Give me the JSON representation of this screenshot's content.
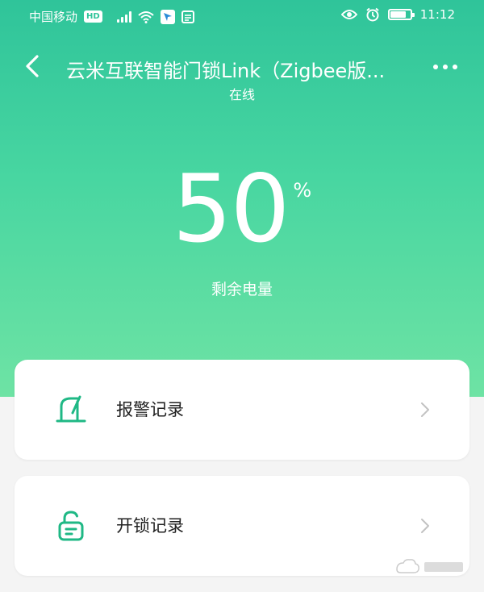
{
  "status_bar": {
    "carrier": "中国移动",
    "network_badge": "HD",
    "time": "11:12",
    "battery_level": 0.8,
    "icons": [
      "signal-icon",
      "wifi-icon",
      "app-notification-icon",
      "message-icon",
      "eye-icon",
      "alarm-icon",
      "battery-icon"
    ]
  },
  "header": {
    "title": "云米互联智能门锁Link（Zigbee版...",
    "status": "在线",
    "back_icon": "back-arrow-icon",
    "more_icon": "more-dots-icon"
  },
  "battery": {
    "value": "50",
    "unit": "%",
    "label": "剩余电量"
  },
  "records": [
    {
      "label": "报警记录",
      "icon": "alarm-record-icon"
    },
    {
      "label": "开锁记录",
      "icon": "unlock-record-icon"
    }
  ],
  "colors": {
    "gradient_top": "#2fc49a",
    "gradient_bottom": "#6ee3a4",
    "accent": "#1fb885",
    "background": "#f4f4f4",
    "card": "#ffffff",
    "chevron": "#c2c2c2"
  }
}
